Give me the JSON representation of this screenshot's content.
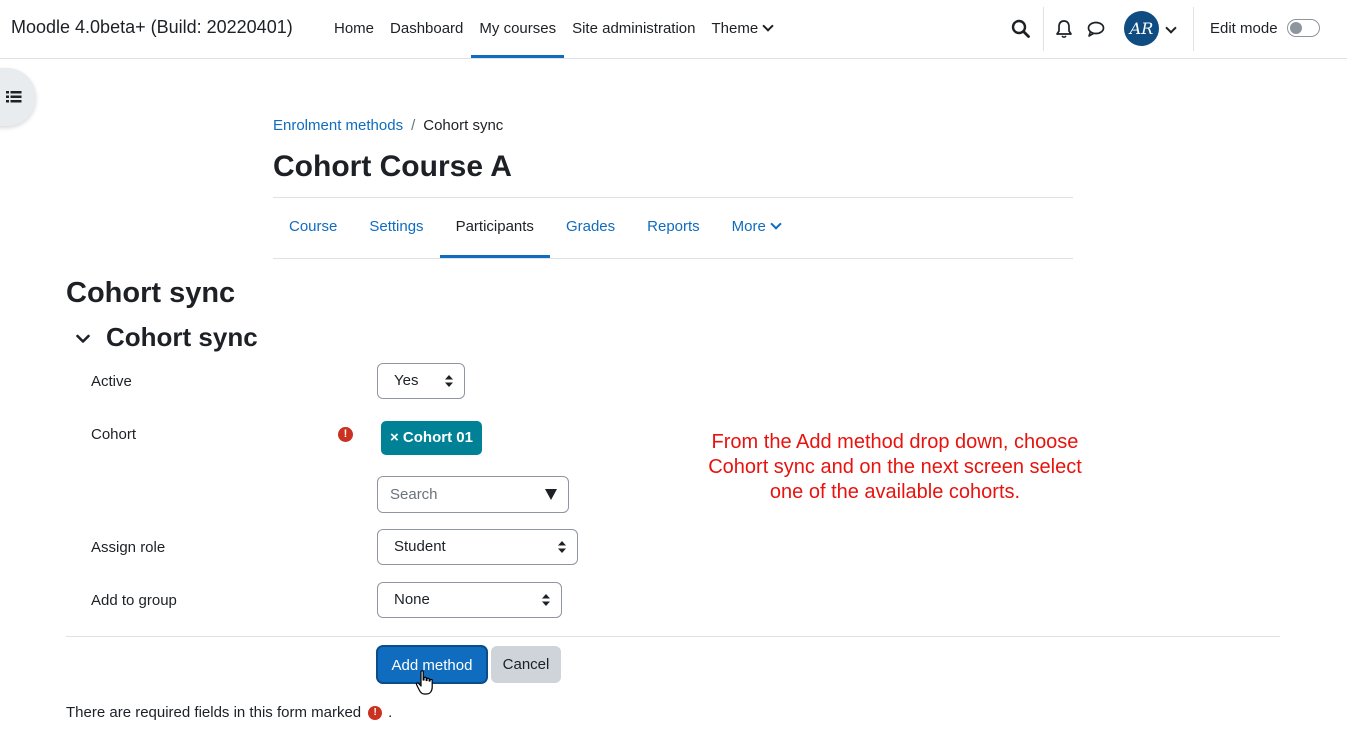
{
  "navbar": {
    "site_name": "Moodle 4.0beta+ (Build: 20220401)",
    "links": [
      "Home",
      "Dashboard",
      "My courses",
      "Site administration",
      "Theme"
    ],
    "active_link": "My courses",
    "user_initials": "AR",
    "edit_mode_label": "Edit mode",
    "edit_mode_on": false,
    "icons": [
      "search-icon",
      "bell-icon",
      "chat-icon",
      "chevron-down-icon"
    ]
  },
  "breadcrumb": {
    "parent": "Enrolment methods",
    "current": "Cohort sync"
  },
  "course": {
    "title": "Cohort Course A"
  },
  "secondary_nav": {
    "tabs": [
      "Course",
      "Settings",
      "Participants",
      "Grades",
      "Reports",
      "More"
    ],
    "active_tab": "Participants"
  },
  "form": {
    "page_heading": "Cohort sync",
    "section_heading": "Cohort sync",
    "active": {
      "label": "Active",
      "value": "Yes"
    },
    "cohort": {
      "label": "Cohort",
      "selected_tag": "× Cohort 01",
      "search_placeholder": "Search"
    },
    "assign_role": {
      "label": "Assign role",
      "value": "Student"
    },
    "add_to_group": {
      "label": "Add to group",
      "value": "None"
    },
    "submit_label": "Add method",
    "cancel_label": "Cancel",
    "required_note": "There are required fields in this form marked",
    "required_note_end": "."
  },
  "annotation": {
    "line1": "From the Add method drop down, choose",
    "line2": "Cohort sync and on the next screen select",
    "line3": "one of the available cohorts."
  },
  "colors": {
    "primary": "#0f6cbf",
    "tag": "#008196",
    "required": "#ca3120",
    "annotation": "#e8130e"
  }
}
